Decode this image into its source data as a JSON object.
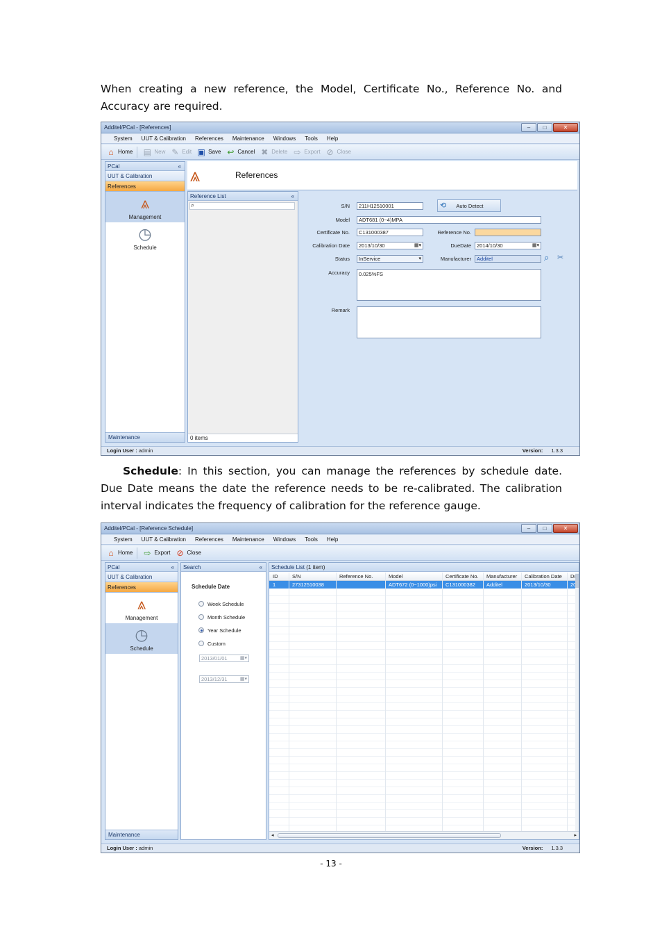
{
  "doc": {
    "intro": "When creating a new reference, the Model, Certificate No., Reference No. and Accuracy are required.",
    "schedule_term": "Schedule",
    "schedule_text": ": In this section, you can manage the references by schedule date. Due Date means the date the reference needs to be re-calibrated. The calibration interval indicates the frequency of calibration for the reference gauge.",
    "page_number": "- 13 -"
  },
  "shot1": {
    "title": "Additel/PCal - [References]",
    "menu": [
      "System",
      "UUT & Calibration",
      "References",
      "Maintenance",
      "Windows",
      "Tools",
      "Help"
    ],
    "toolbar": [
      "Home",
      "New",
      "Edit",
      "Save",
      "Cancel",
      "Delete",
      "Export",
      "Close"
    ],
    "nav": {
      "head": "PCal",
      "chev": "«",
      "uut": "UUT & Calibration",
      "references": "References",
      "management": "Management",
      "schedule": "Schedule",
      "maintenance": "Maintenance"
    },
    "header_title": "References",
    "list": {
      "head": "Reference List",
      "chev": "«",
      "count": "0 items"
    },
    "form": {
      "sn_label": "S/N",
      "sn": "211H12510001",
      "auto_detect": "Auto Detect",
      "model_label": "Model",
      "model": "ADT681 (0~4)MPA",
      "cert_label": "Certificate No.",
      "cert": "C131000387",
      "refno_label": "Reference No.",
      "refno": "",
      "caldate_label": "Calibration Date",
      "caldate": "2013/10/30",
      "duedate_label": "DueDate",
      "duedate": "2014/10/30",
      "status_label": "Status",
      "status": "InService",
      "manufacturer_label": "Manufacturer",
      "manufacturer": "Additel",
      "accuracy_label": "Accuracy",
      "accuracy": "0.025%FS",
      "remark_label": "Remark",
      "remark": ""
    },
    "status": {
      "login_label": "Login User :",
      "login": "admin",
      "version_label": "Version:",
      "version": "1.3.3"
    }
  },
  "shot2": {
    "title": "Additel/PCal - [Reference Schedule]",
    "menu": [
      "System",
      "UUT & Calibration",
      "References",
      "Maintenance",
      "Windows",
      "Tools",
      "Help"
    ],
    "toolbar": [
      "Home",
      "Export",
      "Close"
    ],
    "nav": {
      "head": "PCal",
      "chev": "«",
      "uut": "UUT & Calibration",
      "references": "References",
      "management": "Management",
      "schedule": "Schedule",
      "maintenance": "Maintenance"
    },
    "search": {
      "head": "Search",
      "chev": "«",
      "title": "Schedule Date",
      "options": [
        "Week Schedule",
        "Month Schedule",
        "Year Schedule",
        "Custom"
      ],
      "selected_index": 2,
      "from": "2013/01/01",
      "to": "2013/12/31"
    },
    "grid": {
      "head": "Schedule List",
      "count": "(1 item)",
      "columns": [
        "ID",
        "S/N",
        "Reference No.",
        "Model",
        "Certificate No.",
        "Manufacturer",
        "Calibration Date",
        "Du"
      ],
      "rows": [
        [
          "1",
          "27312510038",
          "",
          "ADT672 (0~1000)psi",
          "C131000382",
          "Additel",
          "2013/10/30",
          "20"
        ]
      ]
    },
    "status": {
      "login_label": "Login User :",
      "login": "admin",
      "version_label": "Version:",
      "version": "1.3.3"
    }
  }
}
